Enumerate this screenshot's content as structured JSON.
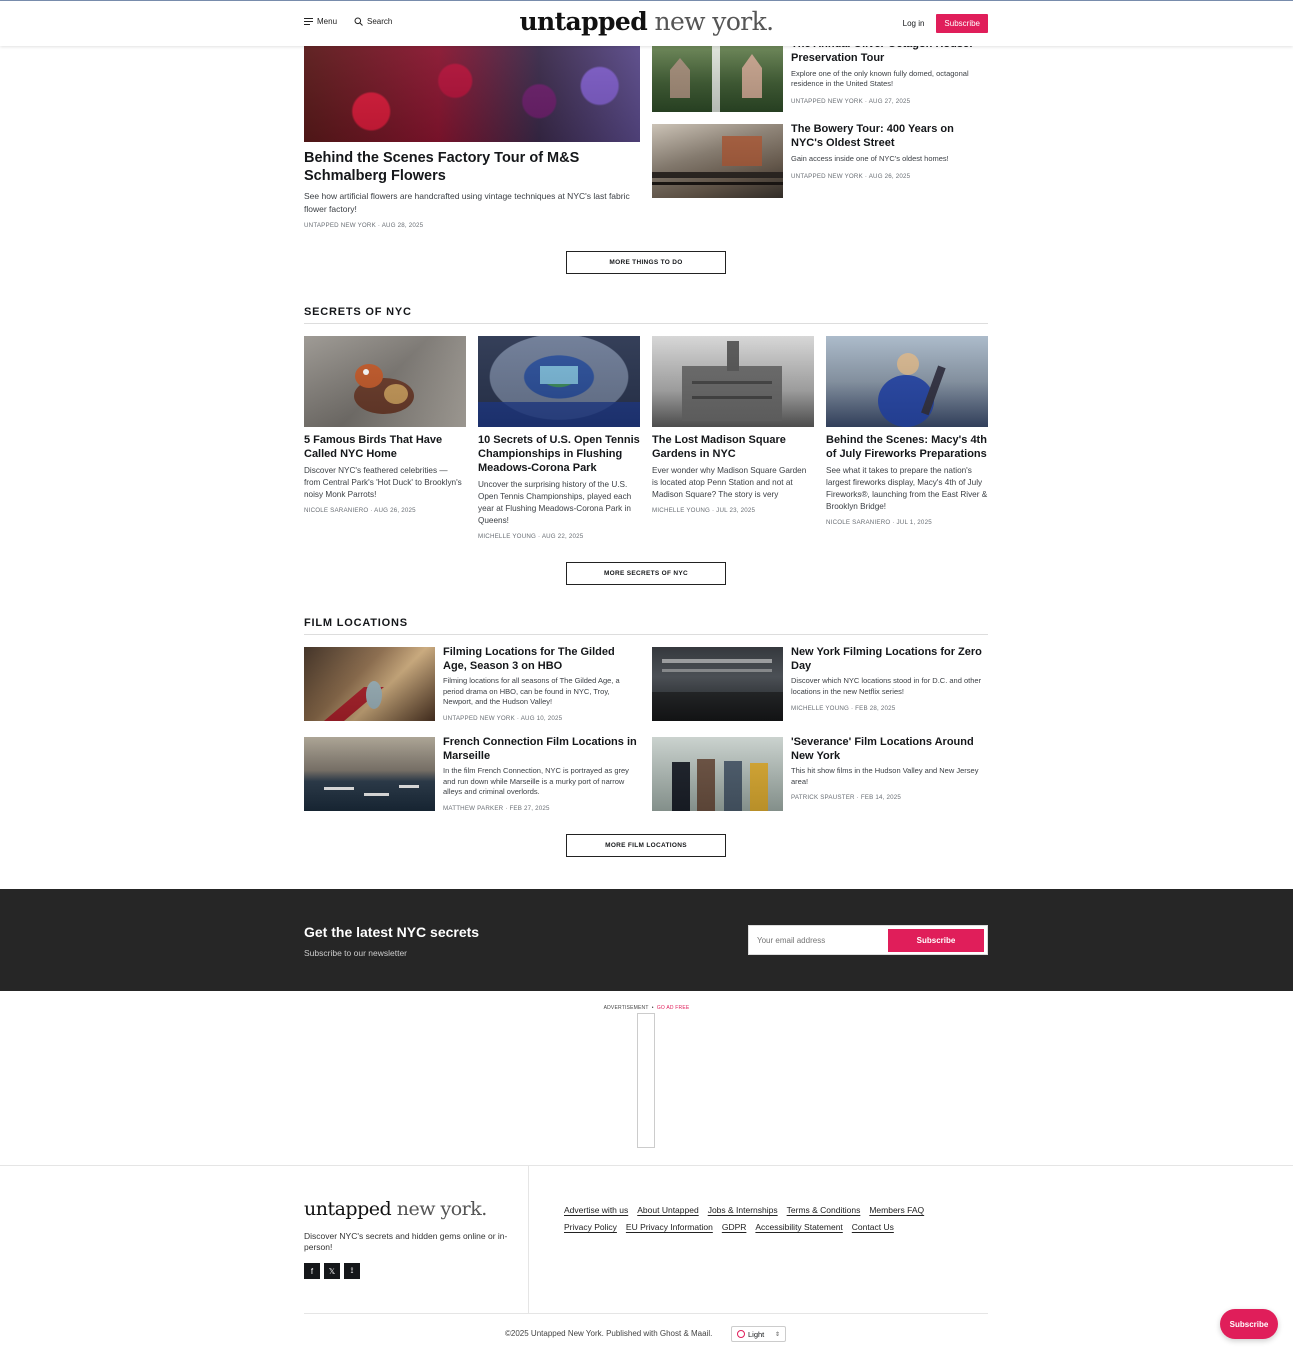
{
  "header": {
    "menu_label": "Menu",
    "search_label": "Search",
    "logo_bold": "untapped",
    "logo_light": " new york.",
    "login_label": "Log in",
    "subscribe_label": "Subscribe"
  },
  "things_to_do": {
    "featured": {
      "title": "Behind the Scenes Factory Tour of M&S Schmalberg Flowers",
      "excerpt": "See how artificial flowers are handcrafted using vintage techniques at NYC's last fabric flower factory!",
      "author": "UNTAPPED NEW YORK",
      "date": "AUG 28, 2025"
    },
    "side": [
      {
        "title": "The Annual Oliver Octagon House: Preservation Tour",
        "excerpt": "Explore one of the only known fully domed, octagonal residence in the United States!",
        "author": "UNTAPPED NEW YORK",
        "date": "AUG 27, 2025"
      },
      {
        "title": "The Bowery Tour: 400 Years on NYC's Oldest Street",
        "excerpt": "Gain access inside one of NYC's oldest homes!",
        "author": "UNTAPPED NEW YORK",
        "date": "AUG 26, 2025"
      }
    ],
    "more_label": "MORE THINGS TO DO"
  },
  "secrets": {
    "heading": "SECRETS OF NYC",
    "cards": [
      {
        "title": "5 Famous Birds That Have Called NYC Home",
        "excerpt": "Discover NYC's feathered celebrities — from Central Park's 'Hot Duck' to Brooklyn's noisy Monk Parrots!",
        "author": "NICOLE SARANIERO",
        "date": "AUG 26, 2025"
      },
      {
        "title": "10 Secrets of U.S. Open Tennis Championships in Flushing Meadows-Corona Park",
        "excerpt": "Uncover the surprising history of the U.S. Open Tennis Championships, played each year at Flushing Meadows-Corona Park in Queens!",
        "author": "MICHELLE YOUNG",
        "date": "AUG 22, 2025"
      },
      {
        "title": "The Lost Madison Square Gardens in NYC",
        "excerpt": "Ever wonder why Madison Square Garden is located atop Penn Station and not at Madison Square? The story is very",
        "author": "MICHELLE YOUNG",
        "date": "JUL 23, 2025"
      },
      {
        "title": "Behind the Scenes: Macy's 4th of July Fireworks Preparations",
        "excerpt": "See what it takes to prepare the nation's largest fireworks display, Macy's 4th of July Fireworks®, launching from the East River & Brooklyn Bridge!",
        "author": "NICOLE SARANIERO",
        "date": "JUL 1, 2025"
      }
    ],
    "more_label": "MORE SECRETS OF NYC"
  },
  "film": {
    "heading": "FILM LOCATIONS",
    "cards": [
      {
        "title": "Filming Locations for The Gilded Age, Season 3 on HBO",
        "excerpt": "Filming locations for all seasons of The Gilded Age, a period drama on HBO, can be found in NYC, Troy, Newport, and the Hudson Valley!",
        "author": "UNTAPPED NEW YORK",
        "date": "AUG 10, 2025"
      },
      {
        "title": "New York Filming Locations for Zero Day",
        "excerpt": "Discover which NYC locations stood in for D.C. and other locations in the new Netflix series!",
        "author": "MICHELLE YOUNG",
        "date": "FEB 28, 2025"
      },
      {
        "title": "French Connection Film Locations in Marseille",
        "excerpt": "In the film French Connection, NYC is portrayed as grey and run down while Marseille is a murky port of narrow alleys and criminal overlords.",
        "author": "MATTHEW PARKER",
        "date": "FEB 27, 2025"
      },
      {
        "title": "'Severance' Film Locations Around New York",
        "excerpt": "This hit show films in the Hudson Valley and New Jersey area!",
        "author": "PATRICK SPAUSTER",
        "date": "FEB 14, 2025"
      }
    ],
    "more_label": "MORE FILM LOCATIONS"
  },
  "newsletter": {
    "title": "Get the latest NYC secrets",
    "subtitle": "Subscribe to our newsletter",
    "placeholder": "Your email address",
    "button": "Subscribe"
  },
  "ad": {
    "label": "ADVERTISEMENT",
    "sep": "•",
    "go_ad_free": "GO AD FREE"
  },
  "footer": {
    "logo_bold": "untapped",
    "logo_light": " new york.",
    "description": "Discover NYC's secrets and hidden gems online or in-person!",
    "links": [
      "Advertise with us",
      "About Untapped",
      "Jobs & Internships",
      "Terms & Conditions",
      "Members FAQ",
      "Privacy Policy",
      "EU Privacy Information",
      "GDPR",
      "Accessibility Statement",
      "Contact Us"
    ],
    "social": [
      "f",
      "𝕏",
      "⟟"
    ],
    "copyright": "©2025 Untapped New York. Published with Ghost & Maail.",
    "theme": "Light"
  },
  "floating_subscribe": "Subscribe",
  "colors": {
    "accent": "#e01e5a",
    "dark_band": "#262626"
  }
}
